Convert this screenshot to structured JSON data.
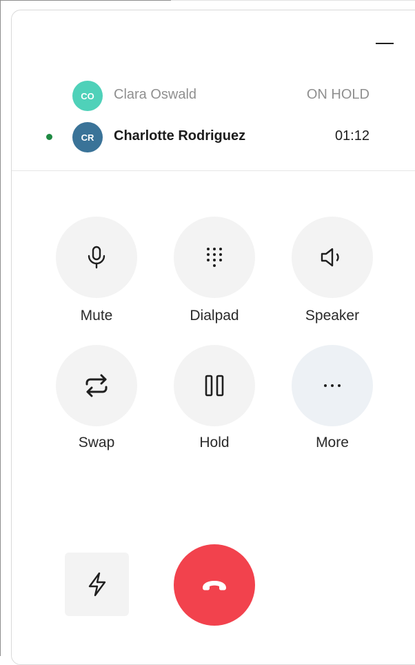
{
  "header": {
    "minimize_icon": "minimize-icon"
  },
  "calls": [
    {
      "initials": "CO",
      "name": "Clara Oswald",
      "status": "ON HOLD",
      "avatar_color": "#4fd1b9"
    },
    {
      "initials": "CR",
      "name": "Charlotte Rodriguez",
      "status": "01:12",
      "avatar_color": "#3a7398",
      "active_indicator_color": "#1f8a43"
    }
  ],
  "controls": {
    "mute": {
      "label": "Mute",
      "icon": "microphone-icon"
    },
    "dialpad": {
      "label": "Dialpad",
      "icon": "dialpad-icon"
    },
    "speaker": {
      "label": "Speaker",
      "icon": "speaker-icon"
    },
    "swap": {
      "label": "Swap",
      "icon": "swap-icon"
    },
    "hold": {
      "label": "Hold",
      "icon": "pause-icon"
    },
    "more": {
      "label": "More",
      "icon": "ellipsis-icon"
    }
  },
  "footer": {
    "quick_action_icon": "lightning-icon",
    "hangup_icon": "hang-up-phone-icon",
    "hangup_color": "#f2424d"
  }
}
